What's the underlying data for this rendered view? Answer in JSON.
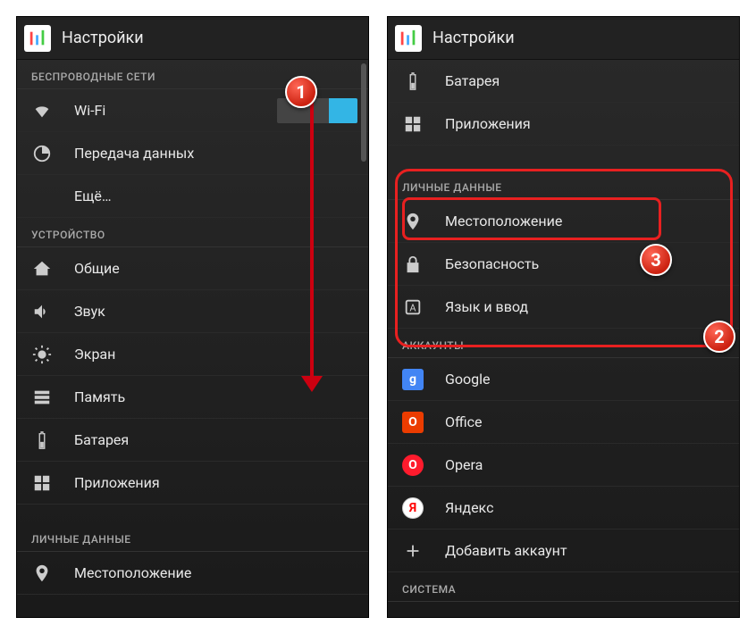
{
  "header": {
    "title": "Настройки"
  },
  "left": {
    "sections": [
      {
        "header": "БЕСПРОВОДНЫЕ СЕТИ",
        "items": [
          {
            "label": "Wi-Fi",
            "toggle": true
          },
          {
            "label": "Передача данных"
          },
          {
            "label": "Ещё…"
          }
        ]
      },
      {
        "header": "УСТРОЙСТВО",
        "items": [
          {
            "label": "Общие"
          },
          {
            "label": "Звук"
          },
          {
            "label": "Экран"
          },
          {
            "label": "Память"
          },
          {
            "label": "Батарея"
          },
          {
            "label": "Приложения"
          }
        ]
      },
      {
        "header": "ЛИЧНЫЕ ДАННЫЕ",
        "items": [
          {
            "label": "Местоположение"
          }
        ]
      }
    ]
  },
  "right": {
    "top_items": [
      {
        "label": "Батарея"
      },
      {
        "label": "Приложения"
      }
    ],
    "sections": [
      {
        "header": "ЛИЧНЫЕ ДАННЫЕ",
        "items": [
          {
            "label": "Местоположение"
          },
          {
            "label": "Безопасность"
          },
          {
            "label": "Язык и ввод"
          }
        ]
      },
      {
        "header": "АККАУНТЫ",
        "items": [
          {
            "label": "Google"
          },
          {
            "label": "Office"
          },
          {
            "label": "Opera"
          },
          {
            "label": "Яндекс"
          },
          {
            "label": "Добавить аккаунт"
          }
        ]
      },
      {
        "header": "СИСТЕМА",
        "items": []
      }
    ]
  },
  "badges": {
    "b1": "1",
    "b2": "2",
    "b3": "3"
  }
}
